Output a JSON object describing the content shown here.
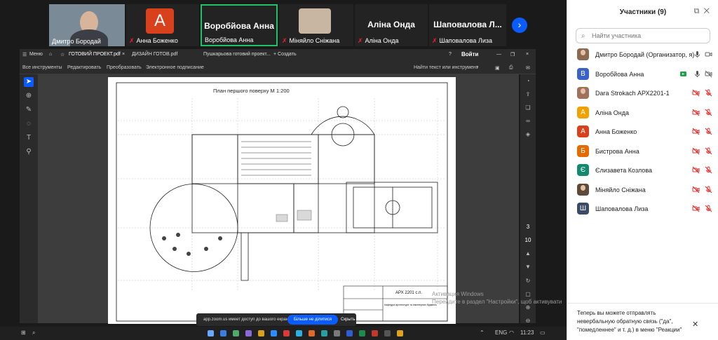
{
  "meeting": {
    "tiles": [
      {
        "name": "Дмитро Бородай",
        "kind": "video"
      },
      {
        "name": "Анна Боженко",
        "kind": "avatar",
        "letter": "А",
        "color": "#d9401c"
      },
      {
        "name": "Воробйова Анна",
        "big": "Воробйова Анна",
        "kind": "name-active"
      },
      {
        "name": "Міняйло Сніжана",
        "kind": "video"
      },
      {
        "name": "Аліна Онда",
        "big": "Аліна Онда",
        "kind": "name"
      },
      {
        "name": "Шаповалова Лиза",
        "big": "Шаповалова Л...",
        "kind": "name"
      }
    ]
  },
  "pdf": {
    "tabs": [
      {
        "label": "Меню"
      },
      {
        "label": "ГОТОВИЙ ПРОЕКТ.pdf"
      },
      {
        "label": "ДИЗАЙН ГОТОВ.pdf"
      },
      {
        "label": "Пушкарьова готовий проект..."
      },
      {
        "label": "+ Создать"
      }
    ],
    "signin": "Войти",
    "toolbar": [
      "Все инструменты",
      "Редактировать",
      "Преобразовать",
      "Электронное подписание"
    ],
    "search_label": "Найти текст или инструмент",
    "page_title": "План першого поверху М 1:200",
    "stamp_code": "АРХ 2201 с.п.",
    "stamp_line": "Кафедра архітектури та інженерних будівель",
    "page_current": "3",
    "page_total": "10"
  },
  "share_banner": {
    "text": "app.zoom.us имеет доступ до вашого екрана.",
    "stop": "Більше не ділитися",
    "hide": "Скрыть"
  },
  "watermark": {
    "line1": "Активация Windows",
    "line2": "Перейдите в раздел \"Настройки\", щоб активувати"
  },
  "taskbar": {
    "lang": "ENG",
    "time": "11:23"
  },
  "participants_panel": {
    "title": "Участники (9)",
    "search_placeholder": "Найти участника",
    "participants": [
      {
        "name": "Дмитро Бородай (Организатор, я)",
        "avatar": "photo",
        "color": "#8b6a4f",
        "video": false,
        "mic": "on"
      },
      {
        "name": "Воробйова Анна",
        "avatar": "В",
        "color": "#3a63c9",
        "video": true,
        "mic": "on"
      },
      {
        "name": "Dara Strokach АРХ2201-1",
        "avatar": "photo",
        "color": "#a0715b",
        "video": false,
        "mic": "off"
      },
      {
        "name": "Аліна Онда",
        "avatar": "А",
        "color": "#f2a100",
        "video": false,
        "mic": "off"
      },
      {
        "name": "Анна Боженко",
        "avatar": "А",
        "color": "#d9401c",
        "video": false,
        "mic": "off"
      },
      {
        "name": "Бистрова Анна",
        "avatar": "Б",
        "color": "#e56a00",
        "video": false,
        "mic": "off"
      },
      {
        "name": "Єлизавета Козлова",
        "avatar": "Є",
        "color": "#138a70",
        "video": false,
        "mic": "off"
      },
      {
        "name": "Міняйло Сніжана",
        "avatar": "photo",
        "color": "#5f4a3a",
        "video": false,
        "mic": "off"
      },
      {
        "name": "Шаповалова Лиза",
        "avatar": "Ш",
        "color": "#3b4a66",
        "video": false,
        "mic": "off"
      }
    ],
    "notice": "Теперь вы можете отправлять невербальную обратную связь (\"да\", \"помедленнее\" и т. д.) в меню \"Реакции\""
  }
}
